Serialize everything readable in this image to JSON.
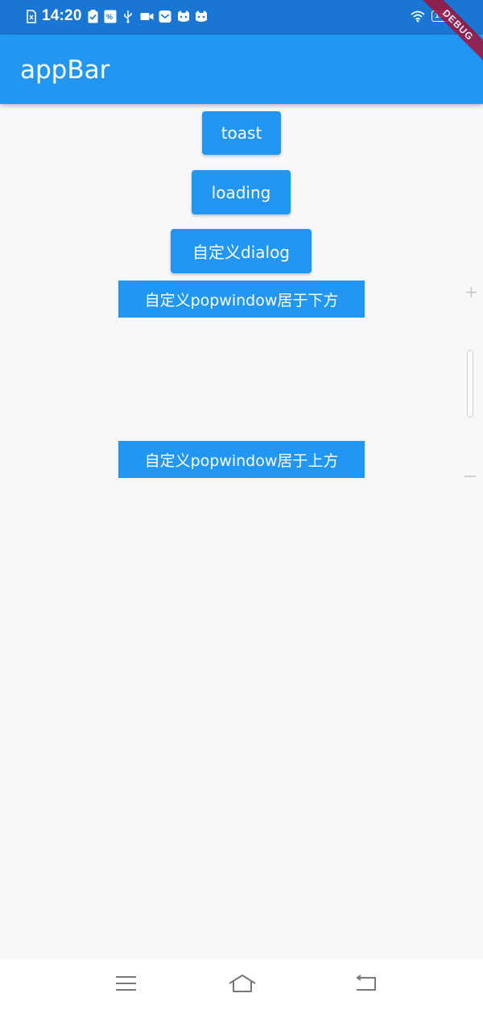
{
  "status_bar": {
    "time": "14:20",
    "battery_level": "100",
    "icons": [
      "sim-x-icon",
      "clipboard-check-icon",
      "data-saver-icon",
      "usb-icon",
      "video-camera-icon",
      "mail-icon",
      "cat-face-icon",
      "cat-face-icon",
      "wifi-icon",
      "battery-icon"
    ]
  },
  "debug_banner": "DEBUG",
  "app_bar": {
    "title": "appBar"
  },
  "buttons": {
    "toast": "toast",
    "loading": "loading",
    "dialog": "自定义dialog",
    "popwindow_below": "自定义popwindow居于下方",
    "popwindow_above": "自定义popwindow居于上方"
  },
  "side_controls": {
    "zoom_in": "+"
  },
  "nav_bar": {
    "items": [
      "menu-icon",
      "home-icon",
      "back-icon"
    ]
  },
  "colors": {
    "status_bar": "#1976d2",
    "app_bar": "#2196f3",
    "button": "#2196f3",
    "background": "#f8f7fa",
    "debug_ribbon": "#a3123a"
  }
}
